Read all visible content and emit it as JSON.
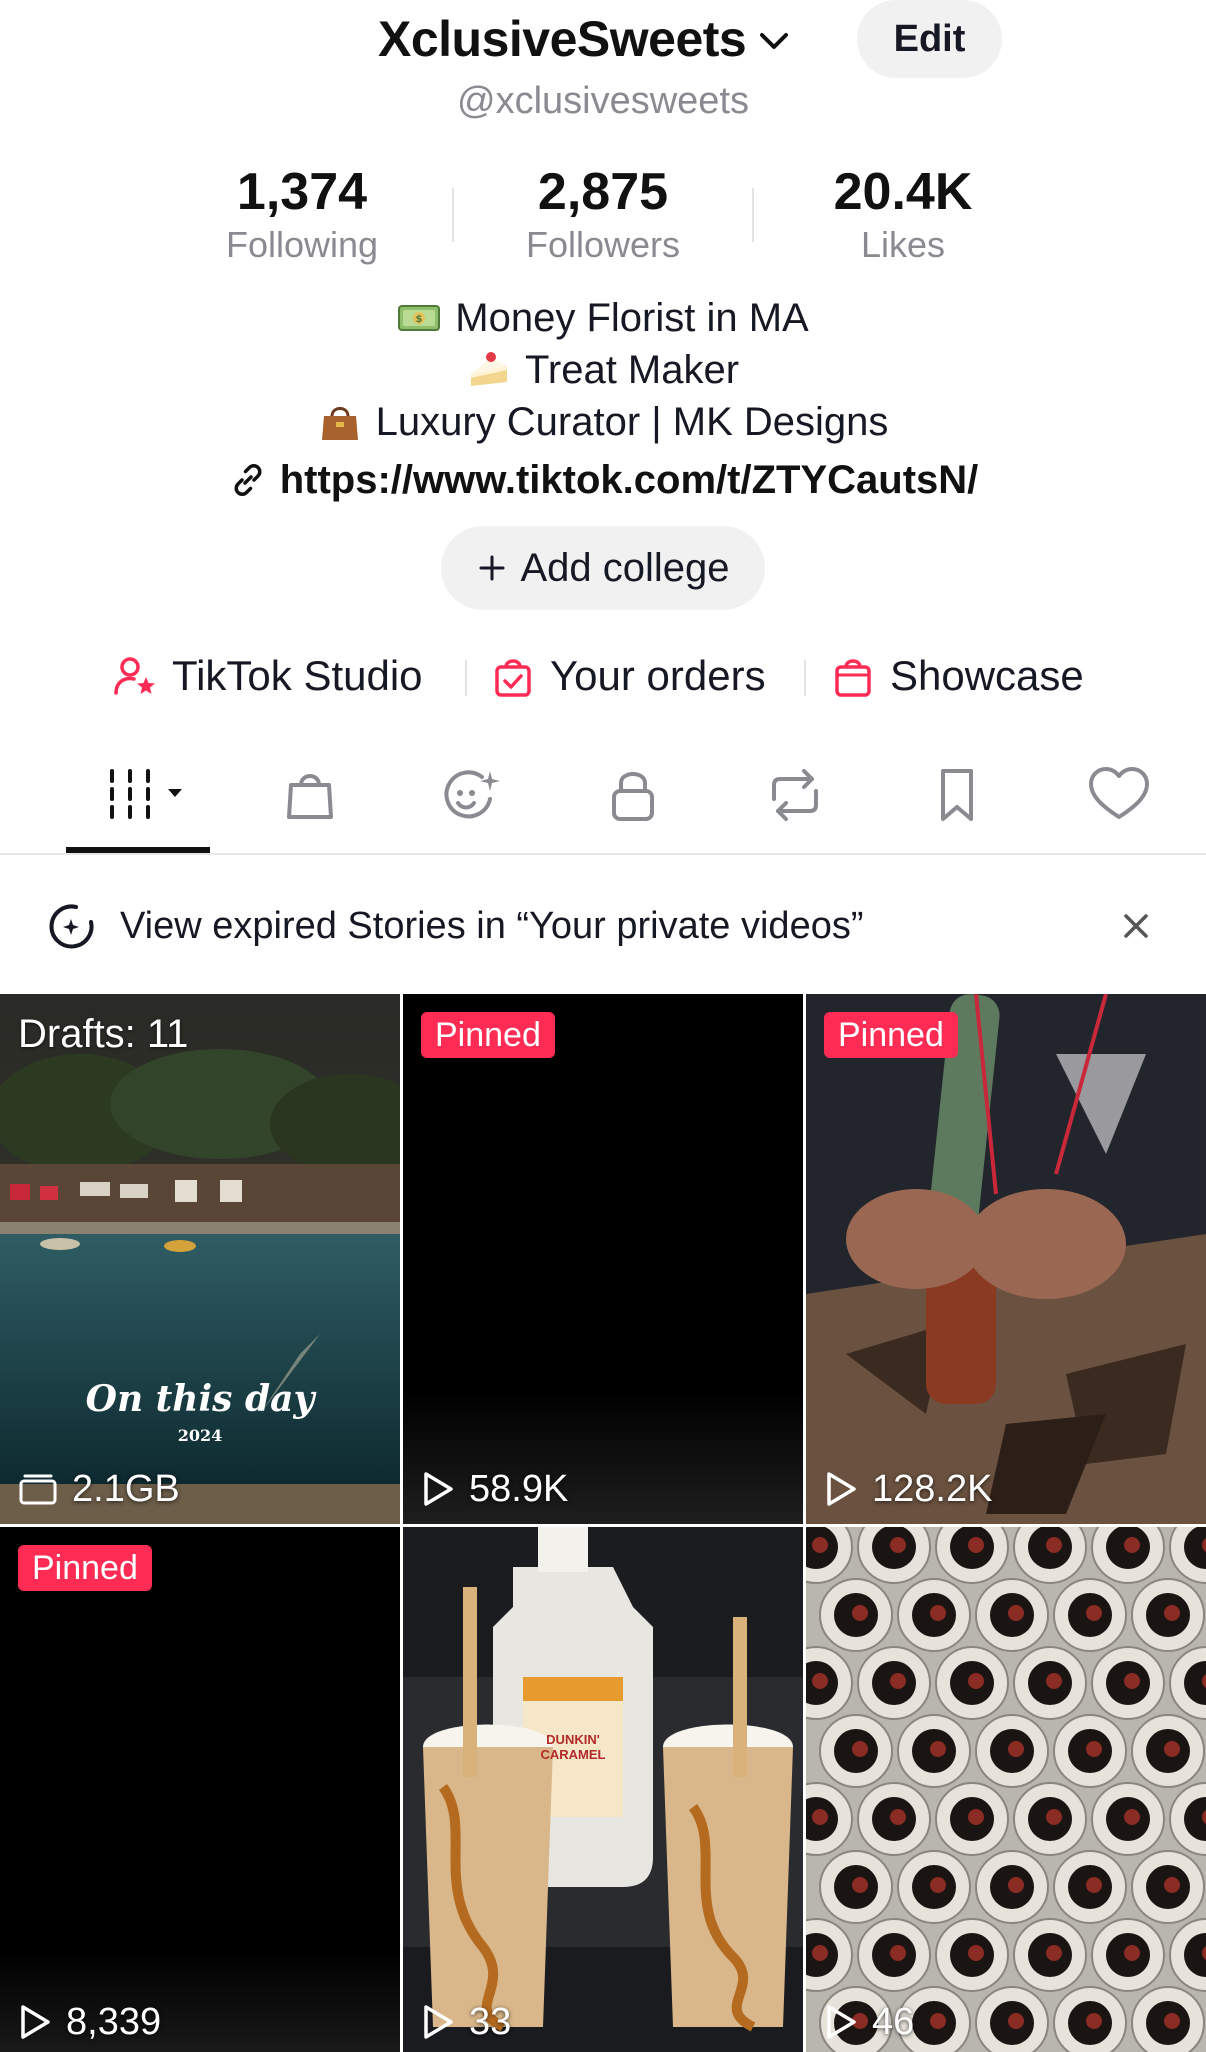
{
  "header": {
    "display_name": "XclusiveSweets",
    "handle": "@xclusivesweets",
    "edit_label": "Edit"
  },
  "stats": [
    {
      "value": "1,374",
      "label": "Following"
    },
    {
      "value": "2,875",
      "label": "Followers"
    },
    {
      "value": "20.4K",
      "label": "Likes"
    }
  ],
  "bio": {
    "lines": [
      {
        "emoji": "money-icon",
        "text": "Money Florist in MA"
      },
      {
        "emoji": "cake-icon",
        "text": "Treat Maker"
      },
      {
        "emoji": "handbag-icon",
        "text": "Luxury Curator | MK Designs"
      }
    ],
    "link": "https://www.tiktok.com/t/ZTYCautsN/"
  },
  "add_college_label": "Add college",
  "tools": [
    {
      "label": "TikTok Studio",
      "icon": "studio-icon"
    },
    {
      "label": "Your orders",
      "icon": "orders-icon"
    },
    {
      "label": "Showcase",
      "icon": "showcase-icon"
    }
  ],
  "tabs": [
    "videos-grid-icon",
    "shop-bag-icon",
    "stories-icon",
    "private-lock-icon",
    "repost-icon",
    "bookmark-icon",
    "liked-heart-icon"
  ],
  "banner": {
    "text": "View expired Stories in “Your private videos”"
  },
  "grid": [
    {
      "overlay": "Drafts: 11",
      "caption": "On this day",
      "year": "2024",
      "stat": "2.1GB",
      "stat_icon": "storage-icon"
    },
    {
      "badge": "Pinned",
      "stat": "58.9K",
      "stat_icon": "play-icon"
    },
    {
      "badge": "Pinned",
      "stat": "128.2K",
      "stat_icon": "play-icon"
    },
    {
      "badge": "Pinned",
      "stat": "8,339",
      "stat_icon": "play-icon"
    },
    {
      "stat": "33",
      "stat_icon": "play-icon",
      "label_text": "DUNKIN' CARAMEL"
    },
    {
      "stat": "46",
      "stat_icon": "play-icon"
    }
  ],
  "colors": {
    "accent": "#fe2c55",
    "text": "#161823",
    "secondary": "#8a8b91",
    "chip_bg": "#f1f1f2"
  }
}
